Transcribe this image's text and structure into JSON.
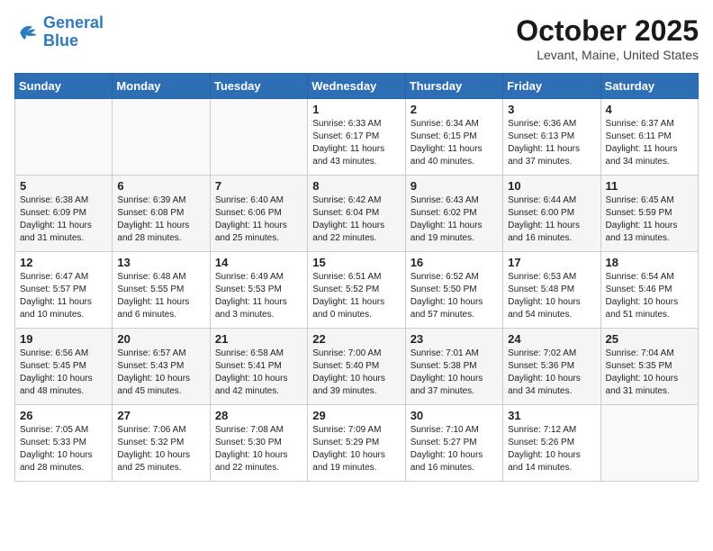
{
  "logo": {
    "line1": "General",
    "line2": "Blue"
  },
  "title": "October 2025",
  "location": "Levant, Maine, United States",
  "weekdays": [
    "Sunday",
    "Monday",
    "Tuesday",
    "Wednesday",
    "Thursday",
    "Friday",
    "Saturday"
  ],
  "weeks": [
    [
      {
        "day": "",
        "info": ""
      },
      {
        "day": "",
        "info": ""
      },
      {
        "day": "",
        "info": ""
      },
      {
        "day": "1",
        "info": "Sunrise: 6:33 AM\nSunset: 6:17 PM\nDaylight: 11 hours\nand 43 minutes."
      },
      {
        "day": "2",
        "info": "Sunrise: 6:34 AM\nSunset: 6:15 PM\nDaylight: 11 hours\nand 40 minutes."
      },
      {
        "day": "3",
        "info": "Sunrise: 6:36 AM\nSunset: 6:13 PM\nDaylight: 11 hours\nand 37 minutes."
      },
      {
        "day": "4",
        "info": "Sunrise: 6:37 AM\nSunset: 6:11 PM\nDaylight: 11 hours\nand 34 minutes."
      }
    ],
    [
      {
        "day": "5",
        "info": "Sunrise: 6:38 AM\nSunset: 6:09 PM\nDaylight: 11 hours\nand 31 minutes."
      },
      {
        "day": "6",
        "info": "Sunrise: 6:39 AM\nSunset: 6:08 PM\nDaylight: 11 hours\nand 28 minutes."
      },
      {
        "day": "7",
        "info": "Sunrise: 6:40 AM\nSunset: 6:06 PM\nDaylight: 11 hours\nand 25 minutes."
      },
      {
        "day": "8",
        "info": "Sunrise: 6:42 AM\nSunset: 6:04 PM\nDaylight: 11 hours\nand 22 minutes."
      },
      {
        "day": "9",
        "info": "Sunrise: 6:43 AM\nSunset: 6:02 PM\nDaylight: 11 hours\nand 19 minutes."
      },
      {
        "day": "10",
        "info": "Sunrise: 6:44 AM\nSunset: 6:00 PM\nDaylight: 11 hours\nand 16 minutes."
      },
      {
        "day": "11",
        "info": "Sunrise: 6:45 AM\nSunset: 5:59 PM\nDaylight: 11 hours\nand 13 minutes."
      }
    ],
    [
      {
        "day": "12",
        "info": "Sunrise: 6:47 AM\nSunset: 5:57 PM\nDaylight: 11 hours\nand 10 minutes."
      },
      {
        "day": "13",
        "info": "Sunrise: 6:48 AM\nSunset: 5:55 PM\nDaylight: 11 hours\nand 6 minutes."
      },
      {
        "day": "14",
        "info": "Sunrise: 6:49 AM\nSunset: 5:53 PM\nDaylight: 11 hours\nand 3 minutes."
      },
      {
        "day": "15",
        "info": "Sunrise: 6:51 AM\nSunset: 5:52 PM\nDaylight: 11 hours\nand 0 minutes."
      },
      {
        "day": "16",
        "info": "Sunrise: 6:52 AM\nSunset: 5:50 PM\nDaylight: 10 hours\nand 57 minutes."
      },
      {
        "day": "17",
        "info": "Sunrise: 6:53 AM\nSunset: 5:48 PM\nDaylight: 10 hours\nand 54 minutes."
      },
      {
        "day": "18",
        "info": "Sunrise: 6:54 AM\nSunset: 5:46 PM\nDaylight: 10 hours\nand 51 minutes."
      }
    ],
    [
      {
        "day": "19",
        "info": "Sunrise: 6:56 AM\nSunset: 5:45 PM\nDaylight: 10 hours\nand 48 minutes."
      },
      {
        "day": "20",
        "info": "Sunrise: 6:57 AM\nSunset: 5:43 PM\nDaylight: 10 hours\nand 45 minutes."
      },
      {
        "day": "21",
        "info": "Sunrise: 6:58 AM\nSunset: 5:41 PM\nDaylight: 10 hours\nand 42 minutes."
      },
      {
        "day": "22",
        "info": "Sunrise: 7:00 AM\nSunset: 5:40 PM\nDaylight: 10 hours\nand 39 minutes."
      },
      {
        "day": "23",
        "info": "Sunrise: 7:01 AM\nSunset: 5:38 PM\nDaylight: 10 hours\nand 37 minutes."
      },
      {
        "day": "24",
        "info": "Sunrise: 7:02 AM\nSunset: 5:36 PM\nDaylight: 10 hours\nand 34 minutes."
      },
      {
        "day": "25",
        "info": "Sunrise: 7:04 AM\nSunset: 5:35 PM\nDaylight: 10 hours\nand 31 minutes."
      }
    ],
    [
      {
        "day": "26",
        "info": "Sunrise: 7:05 AM\nSunset: 5:33 PM\nDaylight: 10 hours\nand 28 minutes."
      },
      {
        "day": "27",
        "info": "Sunrise: 7:06 AM\nSunset: 5:32 PM\nDaylight: 10 hours\nand 25 minutes."
      },
      {
        "day": "28",
        "info": "Sunrise: 7:08 AM\nSunset: 5:30 PM\nDaylight: 10 hours\nand 22 minutes."
      },
      {
        "day": "29",
        "info": "Sunrise: 7:09 AM\nSunset: 5:29 PM\nDaylight: 10 hours\nand 19 minutes."
      },
      {
        "day": "30",
        "info": "Sunrise: 7:10 AM\nSunset: 5:27 PM\nDaylight: 10 hours\nand 16 minutes."
      },
      {
        "day": "31",
        "info": "Sunrise: 7:12 AM\nSunset: 5:26 PM\nDaylight: 10 hours\nand 14 minutes."
      },
      {
        "day": "",
        "info": ""
      }
    ]
  ]
}
